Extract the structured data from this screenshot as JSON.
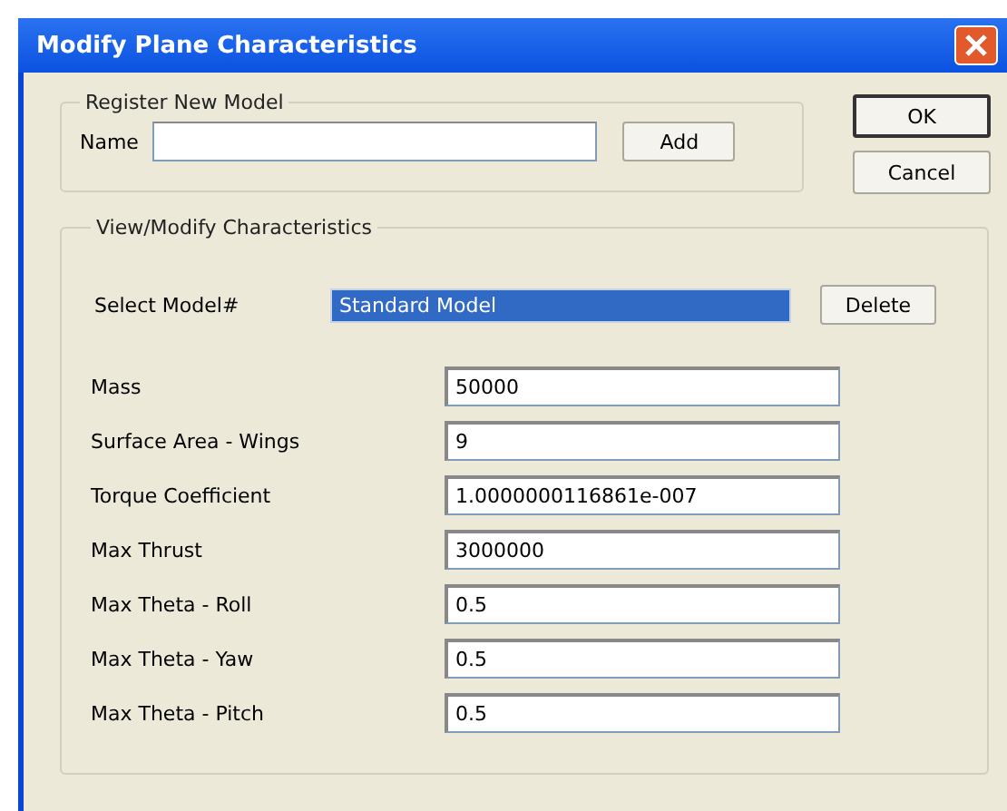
{
  "window": {
    "title": "Modify Plane Characteristics"
  },
  "register_group": {
    "title": "Register New Model",
    "name_label": "Name",
    "add_button": "Add"
  },
  "dialog_buttons": [
    "OK",
    "Cancel"
  ],
  "view_group": {
    "title": "View/Modify Characteristics",
    "select_label": "Select Model#",
    "selected_model": "Standard Model",
    "delete_button": "Delete",
    "fields": [
      {
        "label": "Mass",
        "value": "50000"
      },
      {
        "label": "Surface Area - Wings",
        "value": "9"
      },
      {
        "label": "Torque Coefficient",
        "value": "1.0000000116861e-007"
      },
      {
        "label": "Max Thrust",
        "value": "3000000"
      },
      {
        "label": "Max Theta - Roll",
        "value": "0.5"
      },
      {
        "label": "Max Theta - Yaw",
        "value": "0.5"
      },
      {
        "label": "Max Theta - Pitch",
        "value": "0.5"
      }
    ]
  }
}
